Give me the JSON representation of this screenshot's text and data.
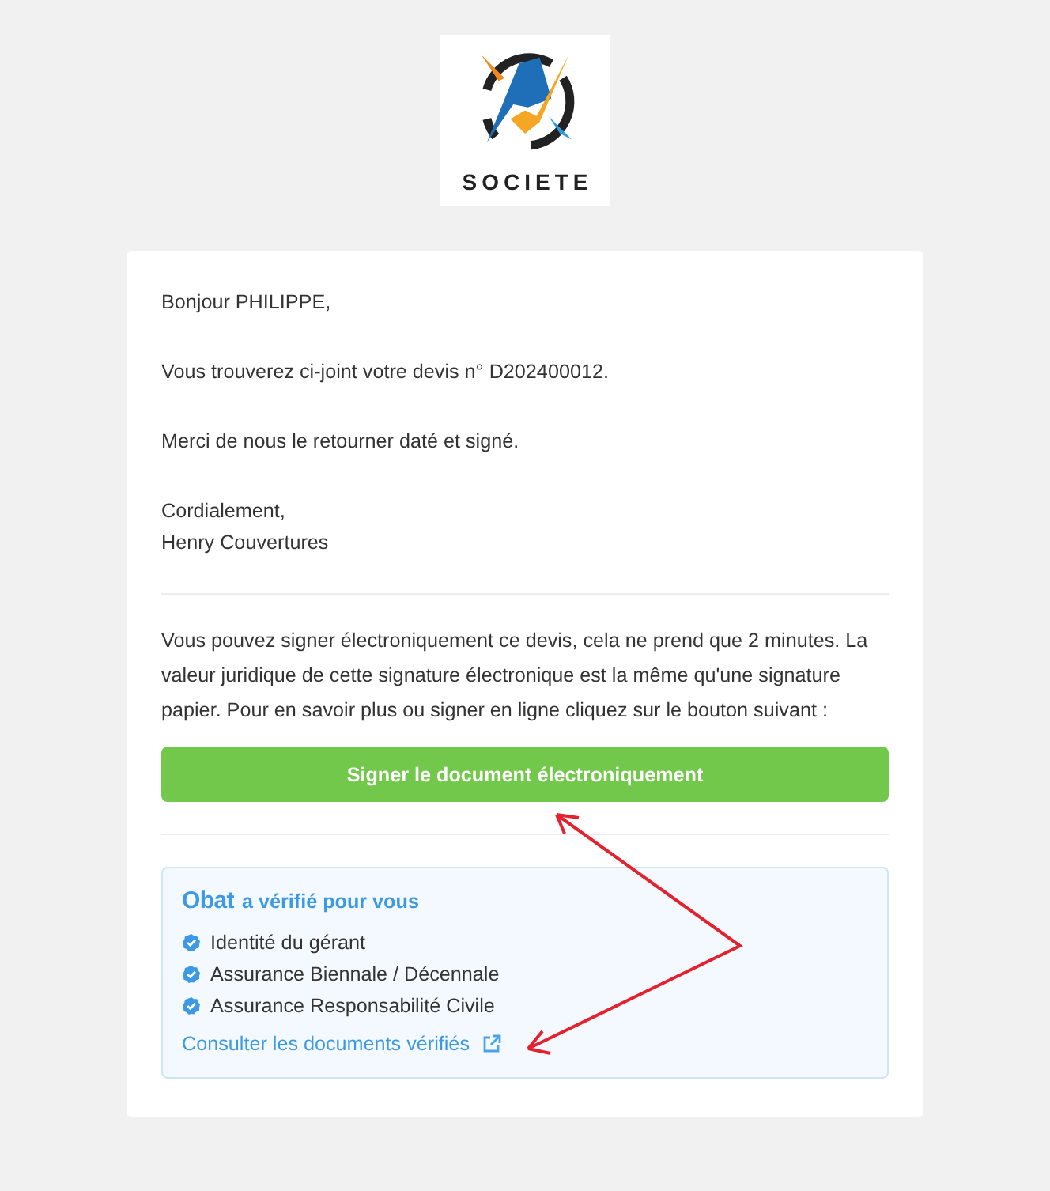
{
  "logo": {
    "name": "SOCIETE"
  },
  "message": {
    "greeting": "Bonjour PHILIPPE,",
    "paragraphs": [
      "Vous trouverez ci-joint votre devis n° D202400012.",
      "Merci de nous le retourner daté et signé."
    ],
    "closing": "Cordialement,",
    "signature": "Henry Couvertures"
  },
  "signing": {
    "text": "Vous pouvez signer électroniquement ce devis, cela ne prend que 2 minutes. La valeur juridique de cette signature électronique est la même qu'une signature papier. Pour en savoir plus ou signer en ligne cliquez sur le bouton suivant :",
    "button": "Signer le document électroniquement"
  },
  "verification": {
    "brand": "Obat",
    "title": "a vérifié pour vous",
    "items": [
      {
        "label": "Identité du gérant",
        "checked": true
      },
      {
        "label": "Assurance Biennale / Décennale",
        "checked": true
      },
      {
        "label": "Assurance Responsabilité Civile",
        "checked": true
      }
    ],
    "link": "Consulter les documents vérifiés"
  }
}
